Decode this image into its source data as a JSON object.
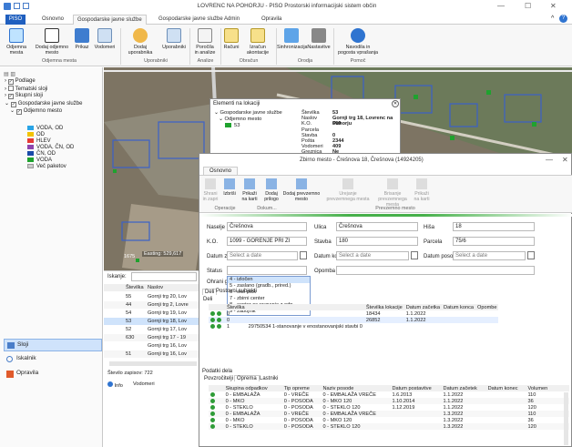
{
  "title": "LOVRENC NA POHORJU - PISO Prostorski informacijski sistem občin",
  "tabs": [
    "PISO",
    "Osnovno",
    "Gospodarske javne službe",
    "Gospodarske javne službe Admin",
    "Opravila"
  ],
  "ribbon": {
    "buttons": [
      [
        "Odjemna",
        "mesta"
      ],
      [
        "Dodaj odjemno",
        "mesto"
      ],
      [
        "Prikaz",
        ""
      ],
      [
        "Vodomeri",
        ""
      ],
      [
        "Dodaj",
        "uporabnika"
      ],
      [
        "Uporabniki",
        ""
      ],
      [
        "Poročila",
        "in analize"
      ],
      [
        "Računi",
        ""
      ],
      [
        "Izračun",
        "akontacije"
      ],
      [
        "Sinhronizacija",
        ""
      ],
      [
        "Nastavitve",
        ""
      ],
      [
        "Navodila in",
        "pogosta vprašanja"
      ]
    ],
    "groups": [
      "Odjemna mesta",
      "Uporabniki",
      "Analize",
      "Obračun",
      "Orodja",
      "Pomoč"
    ]
  },
  "tree": {
    "items": [
      "Podlage",
      "Tematski sloji",
      "Skupni sloji",
      "Gospodarske javne službe",
      "Odjemno mesto"
    ],
    "legend": [
      {
        "label": "VODA, OD",
        "color": "#2aa4e6"
      },
      {
        "label": "OD",
        "color": "#f2c200"
      },
      {
        "label": "HLEV",
        "color": "#e53935"
      },
      {
        "label": "VODA, ČN, OD",
        "color": "#8e44ad"
      },
      {
        "label": "ČN, OD",
        "color": "#1a4aa8"
      },
      {
        "label": "VODA",
        "color": "#1fa22e"
      },
      {
        "label": "Več paketov",
        "color": "#cccccc"
      }
    ]
  },
  "left_bottom": {
    "sloji": "Sloji",
    "iskalnik": "Iskalnik",
    "opravila": "Opravila"
  },
  "popup": {
    "title": "Elementi na lokaciji",
    "tree": [
      "Gospodarske javne službe",
      "Odjemno mesto",
      "53"
    ],
    "labels": [
      "Številka",
      "Naslov",
      "K.O.",
      "Parcela",
      "Stavba",
      "Pošta",
      "Vodomeri",
      "Greznica"
    ],
    "values": [
      "53",
      "Gornji trg 18, Lovrenc na Pohorju",
      "669",
      "",
      "0",
      "2344",
      "409",
      "Ne"
    ]
  },
  "list": {
    "iskanje": "Iskanje:",
    "headers": [
      "Številka",
      "Naslov"
    ],
    "rows": [
      [
        "55",
        "Gornji trg 20, Lov"
      ],
      [
        "44",
        "Gornji trg 2, Lovre"
      ],
      [
        "54",
        "Gornji trg 19, Lov"
      ],
      [
        "53",
        "Gornji trg 18, Lov"
      ],
      [
        "52",
        "Gornji trg 17, Lov"
      ],
      [
        "630",
        "Gornji trg 17 - 19"
      ],
      [
        "",
        "Gornji trg 16, Lov"
      ],
      [
        "51",
        "Gornji trg 16, Lov"
      ]
    ],
    "count": "Število zapisov: 722",
    "count_trunc": "Število z",
    "tabs": [
      "Info",
      "Vodomeri"
    ]
  },
  "map": {
    "coords": "Easting: 529,617",
    "scale": "1675"
  },
  "win2": {
    "title": "Zbirno mesto - Črešnova 18, Črešnova (14924205)",
    "tab": "Osnovno",
    "buttons": [
      [
        "Shrani",
        "in zapri"
      ],
      [
        "Izbriši",
        ""
      ],
      [
        "Prikaži",
        "na karti"
      ],
      [
        "Dodaj",
        "prilogo"
      ],
      [
        "Dodaj prevzemno",
        "mesto"
      ],
      [
        "Urejanje",
        "prevzemnega mesta"
      ],
      [
        "Brisanje",
        "prevzemnega mesta"
      ],
      [
        "Prikaži",
        "na karti"
      ]
    ],
    "groups": [
      "Operacije",
      "Dokum...",
      "Prevzemno mesto"
    ],
    "form": {
      "naselje_l": "Naselje",
      "naselje": "Črešnova",
      "ulica_l": "Ulica",
      "ulica": "Črešnova",
      "hisa_l": "Hiša",
      "hisa": "18",
      "ko_l": "K.O.",
      "ko": "1099 - GORENJE PRI ZI",
      "stavba_l": "Stavba",
      "stavba": "180",
      "parcela_l": "Parcela",
      "parcela": "75/6",
      "dz_l": "Datum začetka",
      "dk_l": "Datum konca",
      "dp_l": "Datum posodobitve",
      "date_ph": "Select a date",
      "status_l": "Status",
      "opomba_l": "Opomba (status)",
      "ograj_l": "Ohrani geometrijo"
    },
    "status_opts": [
      "4 - izločen",
      "5 - zaslano (gradb., prired.)",
      "6 - eko otok",
      "7 - zbirni center",
      "8 - center za ravnanje z odp.",
      "9 - zabojnik"
    ],
    "mid_tabs": [
      "Deli",
      "Postovni subjekti"
    ],
    "deli_label": "Deli",
    "mid_headers": [
      "Številka",
      "",
      "Številka lokacije",
      "Datum začetka",
      "Datum konca",
      "Opombe"
    ],
    "mid_rows": [
      [
        "0",
        "",
        "18434",
        "1.1.2022"
      ],
      [
        "0",
        "",
        "26852",
        "1.1.2022"
      ],
      [
        "1",
        "29750534 1-stanovanje v enostanovanjski stavbi 0",
        "",
        " "
      ]
    ],
    "bottom_label": "Podatki dela",
    "bottom_tabs": [
      "Povzročitelji",
      "Oprema",
      "Lastniki"
    ],
    "bottom_headers": [
      "Skupina odpadkov",
      "Tip opreme",
      "Naziv posode",
      "Datum postavitve",
      "Datum začetek",
      "Datum konec",
      "Volumen"
    ],
    "bottom_rows": [
      [
        "0 - EMBALAŽA",
        "0 - VREČE",
        "0 - EMBALAŽA VREČE",
        "1.6.2013",
        "1.1.2022",
        "",
        "110"
      ],
      [
        "0 - MKO",
        "0 - POSODA",
        "0 - MKO 120",
        "1.10.2014",
        "1.1.2022",
        "",
        "36"
      ],
      [
        "0 - STEKLO",
        "0 - POSODA",
        "0 - STEKLO 120",
        "1.12.2019",
        "1.1.2022",
        "",
        "120"
      ],
      [
        "0 - EMBALAŽA",
        "0 - VREČE",
        "0 - EMBALAŽA VREČE",
        "",
        "1.3.2022",
        "",
        "110"
      ],
      [
        "0 - MKO",
        "0 - POSODA",
        "0 - MKO 120",
        "",
        "1.3.2022",
        "",
        "36"
      ],
      [
        "0 - STEKLO",
        "0 - POSODA",
        "0 - STEKLO 120",
        "",
        "1.3.2022",
        "",
        "120"
      ]
    ]
  }
}
